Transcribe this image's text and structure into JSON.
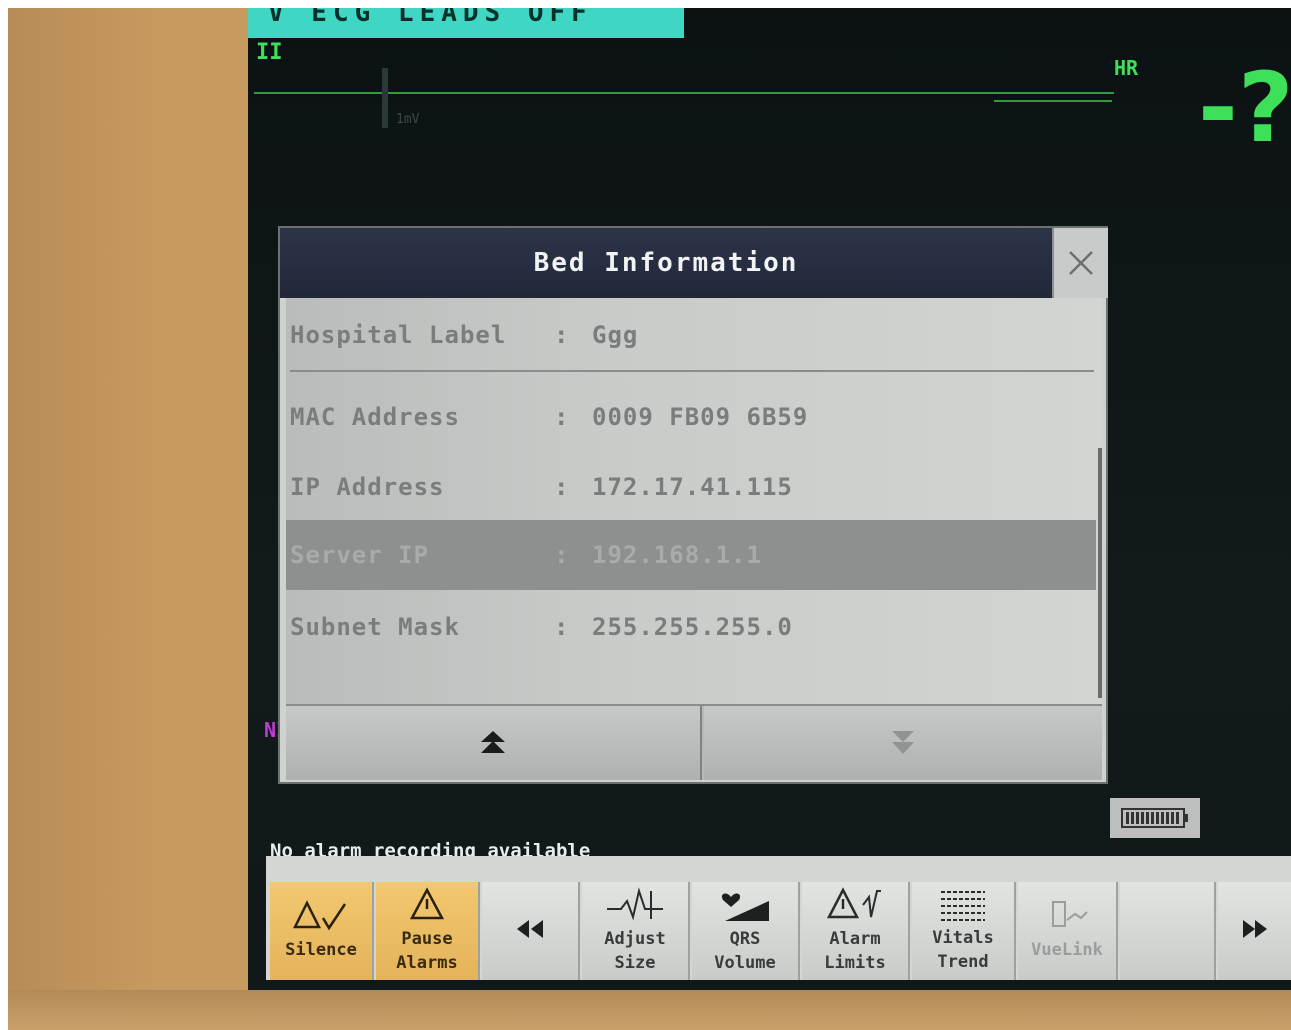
{
  "monitor": {
    "ecg_alarm_text": "V ECG    LEADS OFF",
    "lead_label": "II",
    "ecg_scale_label": "1mV",
    "hr_label": "HR",
    "hr_value": "-?",
    "nbp_label": "NI"
  },
  "dialog": {
    "title": "Bed Information",
    "rows": [
      {
        "label": "Hospital Label",
        "sep": ":",
        "value": "Ggg"
      },
      {
        "label": "MAC Address",
        "sep": ":",
        "value": "0009 FB09 6B59"
      },
      {
        "label": "IP Address",
        "sep": ":",
        "value": "172.17.41.115"
      },
      {
        "label": "Server IP",
        "sep": ":",
        "value": "192.168.1.1"
      },
      {
        "label": "Subnet Mask",
        "sep": ":",
        "value": "255.255.255.0"
      }
    ],
    "selected_row": "Server IP"
  },
  "status": {
    "message": "No alarm recording available"
  },
  "softkeys": {
    "silence": "Silence",
    "pause_1": "Pause",
    "pause_2": "Alarms",
    "adjust_1": "Adjust",
    "adjust_2": "Size",
    "qrs_1": "QRS",
    "qrs_2": "Volume",
    "alarm_1": "Alarm",
    "alarm_2": "Limits",
    "vitals_1": "Vitals",
    "vitals_2": "Trend",
    "vuelink": "VueLink"
  },
  "colors": {
    "ecg_green": "#3ee05a",
    "alarm_cyan": "#3fd6c3",
    "dialog_title_bg": "#2d3448",
    "softkey_amber": "#f2c870",
    "nbp_magenta": "#c13cd8"
  }
}
